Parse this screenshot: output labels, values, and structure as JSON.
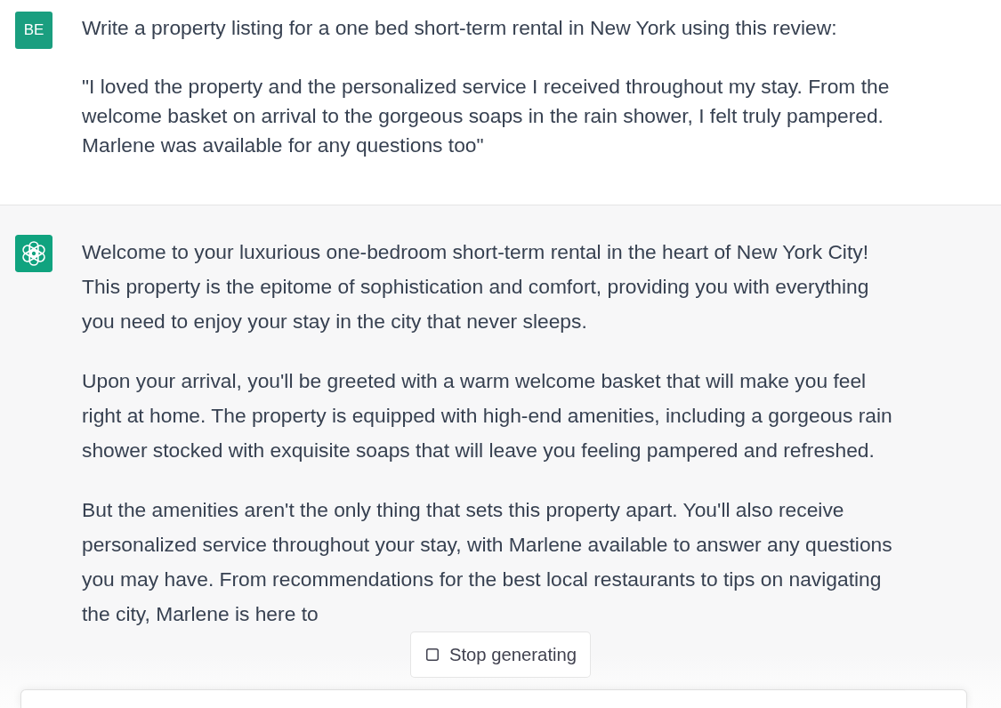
{
  "conversation": [
    {
      "kind": "user",
      "avatar": "BE",
      "paragraphs": [
        "Write a property listing for a one bed short-term rental in New York using this review:",
        "\"I loved the property and the personalized service I received throughout my stay. From the welcome basket on arrival to the gorgeous soaps in the rain shower, I felt truly pampered. Marlene was available for any questions too\""
      ]
    },
    {
      "kind": "assistant",
      "paragraphs": [
        "Welcome to your luxurious one-bedroom short-term rental in the heart of New York City! This property is the epitome of sophistication and comfort, providing you with everything you need to enjoy your stay in the city that never sleeps.",
        "Upon your arrival, you'll be greeted with a warm welcome basket that will make you feel right at home. The property is equipped with high-end amenities, including a gorgeous rain shower stocked with exquisite soaps that will leave you feeling pampered and refreshed.",
        "But the amenities aren't the only thing that sets this property apart. You'll also receive personalized service throughout your stay, with Marlene available to answer any questions you may have. From recommendations for the best local restaurants to tips on navigating the city, Marlene is here to"
      ]
    }
  ],
  "stop_button": {
    "label": "Stop generating"
  }
}
